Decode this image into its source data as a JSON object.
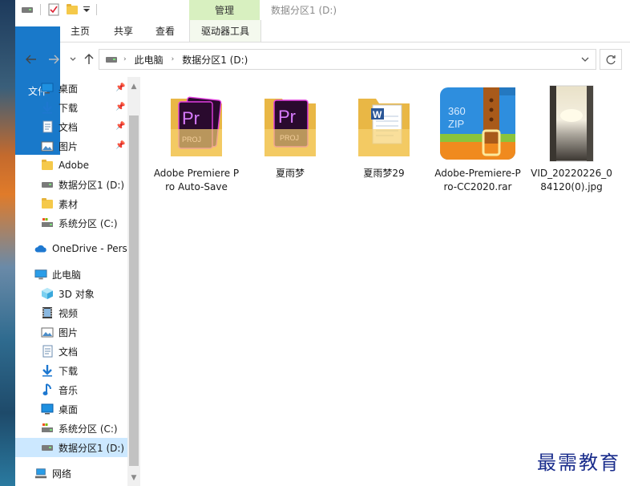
{
  "title_bar": {
    "context_tab": "管理",
    "window_title": "数据分区1 (D:)"
  },
  "ribbon": {
    "tabs": [
      "文件",
      "主页",
      "共享",
      "查看"
    ],
    "context_tab": "驱动器工具"
  },
  "address": {
    "segments": [
      "此电脑",
      "数据分区1 (D:)"
    ]
  },
  "nav_pane": {
    "quick_access": [
      {
        "label": "桌面",
        "icon": "desktop-icon",
        "pinned": true
      },
      {
        "label": "下载",
        "icon": "download-icon",
        "pinned": true
      },
      {
        "label": "文档",
        "icon": "document-icon",
        "pinned": true
      },
      {
        "label": "图片",
        "icon": "picture-icon",
        "pinned": true
      },
      {
        "label": "Adobe",
        "icon": "folder-icon",
        "pinned": false
      },
      {
        "label": "数据分区1 (D:)",
        "icon": "drive-icon",
        "pinned": false
      },
      {
        "label": "素材",
        "icon": "folder-icon",
        "pinned": false
      },
      {
        "label": "系统分区 (C:)",
        "icon": "system-drive-icon",
        "pinned": false
      }
    ],
    "onedrive": "OneDrive - Perso",
    "this_pc": "此电脑",
    "this_pc_items": [
      {
        "label": "3D 对象",
        "icon": "3d-objects-icon"
      },
      {
        "label": "视频",
        "icon": "video-icon"
      },
      {
        "label": "图片",
        "icon": "picture-icon"
      },
      {
        "label": "文档",
        "icon": "document-icon"
      },
      {
        "label": "下载",
        "icon": "download-icon"
      },
      {
        "label": "音乐",
        "icon": "music-icon"
      },
      {
        "label": "桌面",
        "icon": "desktop-icon"
      },
      {
        "label": "系统分区 (C:)",
        "icon": "system-drive-icon"
      },
      {
        "label": "数据分区1 (D:)",
        "icon": "drive-icon",
        "selected": true
      }
    ],
    "network": "网络"
  },
  "files": [
    {
      "name": "Adobe Premiere Pro Auto-Save",
      "icon": "premiere-folder-icon"
    },
    {
      "name": "夏雨梦",
      "icon": "premiere-folder-icon"
    },
    {
      "name": "夏雨梦29",
      "icon": "word-folder-icon"
    },
    {
      "name": "Adobe-Premiere-Pro-CC2020.rar",
      "icon": "360zip-archive-icon"
    },
    {
      "name": "VID_20220226_084120(0).jpg",
      "icon": "image-thumbnail-icon"
    }
  ],
  "watermark": "最需教育"
}
